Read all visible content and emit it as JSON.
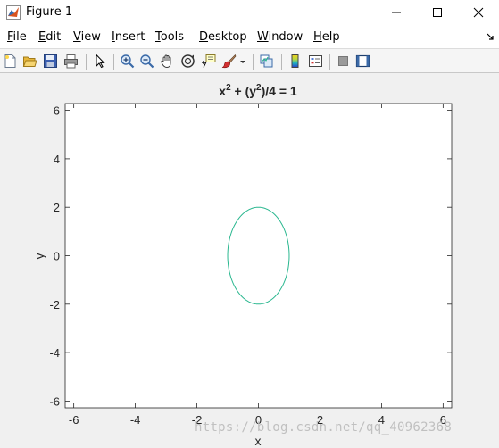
{
  "window": {
    "title": "Figure 1",
    "buttons": [
      "minimize",
      "maximize",
      "close"
    ]
  },
  "menu": {
    "items": [
      {
        "label": "File",
        "underline": "F",
        "rest": "ile"
      },
      {
        "label": "Edit",
        "underline": "E",
        "rest": "dit"
      },
      {
        "label": "View",
        "underline": "V",
        "rest": "iew"
      },
      {
        "label": "Insert",
        "underline": "I",
        "rest": "nsert"
      },
      {
        "label": "Tools",
        "underline": "T",
        "rest": "ools"
      },
      {
        "label": "Desktop",
        "underline": "D",
        "rest": "esktop"
      },
      {
        "label": "Window",
        "underline": "W",
        "rest": "indow"
      },
      {
        "label": "Help",
        "underline": "H",
        "rest": "elp"
      }
    ]
  },
  "toolbar": {
    "icons": [
      "new-figure-icon",
      "open-file-icon",
      "save-icon",
      "print-icon",
      "edit-plot-icon",
      "zoom-in-icon",
      "zoom-out-icon",
      "pan-icon",
      "rotate-3d-icon",
      "data-cursor-icon",
      "brush-icon",
      "brush-dropdown-icon",
      "link-plot-icon",
      "colorbar-icon",
      "legend-icon",
      "hide-plot-tools-icon",
      "show-plot-tools-icon"
    ]
  },
  "chart_data": {
    "type": "line",
    "title_base": "x",
    "title_exp1": "2",
    "title_mid": " + (y",
    "title_exp2": "2",
    "title_end": ")/4 = 1",
    "xlabel": "x",
    "ylabel": "y",
    "xlim": [
      -6.28,
      6.28
    ],
    "ylim": [
      -6.28,
      6.28
    ],
    "xticks": [
      -6,
      -4,
      -2,
      0,
      2,
      4,
      6
    ],
    "yticks": [
      -6,
      -4,
      -2,
      0,
      2,
      4,
      6
    ],
    "xtick_labels": [
      "-6",
      "-4",
      "-2",
      "0",
      "2",
      "4",
      "6"
    ],
    "ytick_labels": [
      "-6",
      "-4",
      "-2",
      "0",
      "2",
      "4",
      "6"
    ],
    "grid": false,
    "series": [
      {
        "equation": "x^2 + y^2/4 = 1",
        "color": "#2ab78f",
        "center": [
          0,
          0
        ],
        "semi_axis_x": 1,
        "semi_axis_y": 2
      }
    ]
  },
  "watermark": "https://blog.csdn.net/qq_40962368"
}
